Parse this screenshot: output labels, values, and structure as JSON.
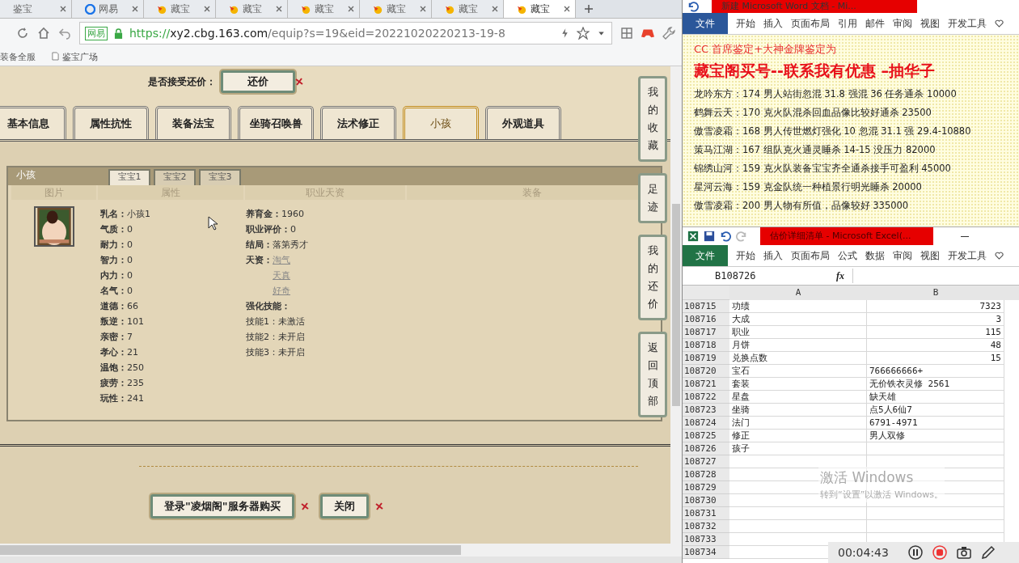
{
  "browser": {
    "tabs": [
      {
        "label": "鉴宝",
        "kind": "plain",
        "selected": false
      },
      {
        "label": "网易",
        "kind": "site",
        "selected": false
      },
      {
        "label": "藏宝",
        "kind": "game",
        "selected": false
      },
      {
        "label": "藏宝",
        "kind": "game",
        "selected": false
      },
      {
        "label": "藏宝",
        "kind": "game",
        "selected": false
      },
      {
        "label": "藏宝",
        "kind": "game",
        "selected": false
      },
      {
        "label": "藏宝",
        "kind": "game",
        "selected": false
      },
      {
        "label": "藏宝",
        "kind": "game",
        "selected": true
      }
    ],
    "cert_label": "网易",
    "url_scheme": "https://",
    "url_host": "xy2.cbg.163.com",
    "url_path": "/equip?s=19&eid=20221020220213-19-8",
    "bookmarks": [
      "装备全服",
      "鉴宝广场"
    ]
  },
  "page": {
    "counter_offer_label": "是否接受还价：",
    "counter_offer_button": "还价",
    "tabs": [
      {
        "label": "基本信息",
        "selected": false
      },
      {
        "label": "属性抗性",
        "selected": false
      },
      {
        "label": "装备法宝",
        "selected": false
      },
      {
        "label": "坐骑召唤兽",
        "selected": false
      },
      {
        "label": "法术修正",
        "selected": false
      },
      {
        "label": "小孩",
        "selected": true
      },
      {
        "label": "外观道具",
        "selected": false
      }
    ],
    "panel": {
      "title": "小孩",
      "subtabs": [
        {
          "label": "宝宝1",
          "selected": true
        },
        {
          "label": "宝宝2",
          "selected": false
        },
        {
          "label": "宝宝3",
          "selected": false
        }
      ],
      "columns": [
        "图片",
        "属性",
        "职业天资",
        "装备"
      ],
      "attributes": [
        {
          "label": "乳名：",
          "value": "小孩1"
        },
        {
          "label": "气质：",
          "value": "0"
        },
        {
          "label": "耐力：",
          "value": "0"
        },
        {
          "label": "智力：",
          "value": "0"
        },
        {
          "label": "内力：",
          "value": "0"
        },
        {
          "label": "名气：",
          "value": "0"
        },
        {
          "label": "道德：",
          "value": "66"
        },
        {
          "label": "叛逆：",
          "value": "101"
        },
        {
          "label": "亲密：",
          "value": "7"
        },
        {
          "label": "孝心：",
          "value": "21"
        },
        {
          "label": "温饱：",
          "value": "250"
        },
        {
          "label": "疲劳：",
          "value": "235"
        },
        {
          "label": "玩性：",
          "value": "241"
        }
      ],
      "career": [
        {
          "label": "养育金：",
          "value": "1960"
        },
        {
          "label": "职业评价：",
          "value": "0"
        },
        {
          "label": "结局：",
          "value": "落第秀才"
        }
      ],
      "talent_label": "天资：",
      "talents": [
        "淘气",
        "天真",
        "好奇"
      ],
      "skills_heading": "强化技能：",
      "skills": [
        {
          "label": "技能1：",
          "value": "未激活"
        },
        {
          "label": "技能2：",
          "value": "未开启"
        },
        {
          "label": "技能3：",
          "value": "未开启"
        }
      ]
    },
    "buttons": [
      "登录\"凌烟阁\"服务器购买",
      "关闭"
    ],
    "side_buttons": [
      "我的收藏",
      "足迹",
      "我的还价",
      "返回顶部"
    ]
  },
  "word": {
    "title": "新建 Microsoft Word 文档 - Mi...",
    "ribbon": [
      {
        "label": "文件",
        "selected": true
      },
      {
        "label": "开始",
        "selected": false
      },
      {
        "label": "插入",
        "selected": false
      },
      {
        "label": "页面布局",
        "selected": false
      },
      {
        "label": "引用",
        "selected": false
      },
      {
        "label": "邮件",
        "selected": false
      },
      {
        "label": "审阅",
        "selected": false
      },
      {
        "label": "视图",
        "selected": false
      },
      {
        "label": "开发工具",
        "selected": false
      }
    ],
    "banner": "CC 首席鉴定+大神金牌鉴定为",
    "headline": "藏宝阁买号--联系我有优惠 –抽华子",
    "lines": [
      "龙吟东方：174 男人站街忽混 31.8 强混 36 任务通杀 10000",
      "鹤舞云天：170 克火队混杀回血品像比较好通杀 23500",
      "傲雪凌霜：168 男人传世燃灯强化 10 忽混 31.1 强 29.4-10880",
      "策马江湖：167 组队克火通灵睡杀 14-15 没压力 82000",
      "锦绣山河：159 克火队装备宝宝齐全通杀接手可盈利 45000",
      "星河云海：159 克金队统一种植景行明光睡杀 20000",
      "傲雪凌霜：200 男人物有所值，品像较好 335000"
    ]
  },
  "excel": {
    "title": "估价详细清单 - Microsoft Excel(...",
    "ribbon": [
      {
        "label": "文件",
        "selected": true
      },
      {
        "label": "开始",
        "selected": false
      },
      {
        "label": "插入",
        "selected": false
      },
      {
        "label": "页面布局",
        "selected": false
      },
      {
        "label": "公式",
        "selected": false
      },
      {
        "label": "数据",
        "selected": false
      },
      {
        "label": "审阅",
        "selected": false
      },
      {
        "label": "视图",
        "selected": false
      },
      {
        "label": "开发工具",
        "selected": false
      }
    ],
    "name_box": "B108726",
    "function_label": "fx",
    "columns": [
      "A",
      "B"
    ],
    "rows": [
      {
        "n": "108715",
        "a": "功绩",
        "b": "7323",
        "kind": "number"
      },
      {
        "n": "108716",
        "a": "大成",
        "b": "3",
        "kind": "number"
      },
      {
        "n": "108717",
        "a": "职业",
        "b": "115",
        "kind": "number"
      },
      {
        "n": "108718",
        "a": "月饼",
        "b": "48",
        "kind": "number"
      },
      {
        "n": "108719",
        "a": "兑换点数",
        "b": "15",
        "kind": "number"
      },
      {
        "n": "108720",
        "a": "宝石",
        "b": "766666666+",
        "kind": "text"
      },
      {
        "n": "108721",
        "a": "套装",
        "b": "无价铁衣灵修 2561",
        "kind": "text"
      },
      {
        "n": "108722",
        "a": "星盘",
        "b": "缺天雄",
        "kind": "text"
      },
      {
        "n": "108723",
        "a": "坐骑",
        "b": "点5人6仙7",
        "kind": "text"
      },
      {
        "n": "108724",
        "a": "法门",
        "b": "6791-4971",
        "kind": "text"
      },
      {
        "n": "108725",
        "a": "修正",
        "b": "男人双修",
        "kind": "text"
      },
      {
        "n": "108726",
        "a": "孩子",
        "kind": "text"
      },
      {
        "n": "108727"
      },
      {
        "n": "108728"
      },
      {
        "n": "108729"
      },
      {
        "n": "108730"
      },
      {
        "n": "108731"
      },
      {
        "n": "108732"
      },
      {
        "n": "108733"
      },
      {
        "n": "108734"
      }
    ]
  },
  "activation": {
    "title": "激活 Windows",
    "hint": "转到“设置”以激活 Windows。"
  },
  "recorder": {
    "time": "00:04:43"
  }
}
